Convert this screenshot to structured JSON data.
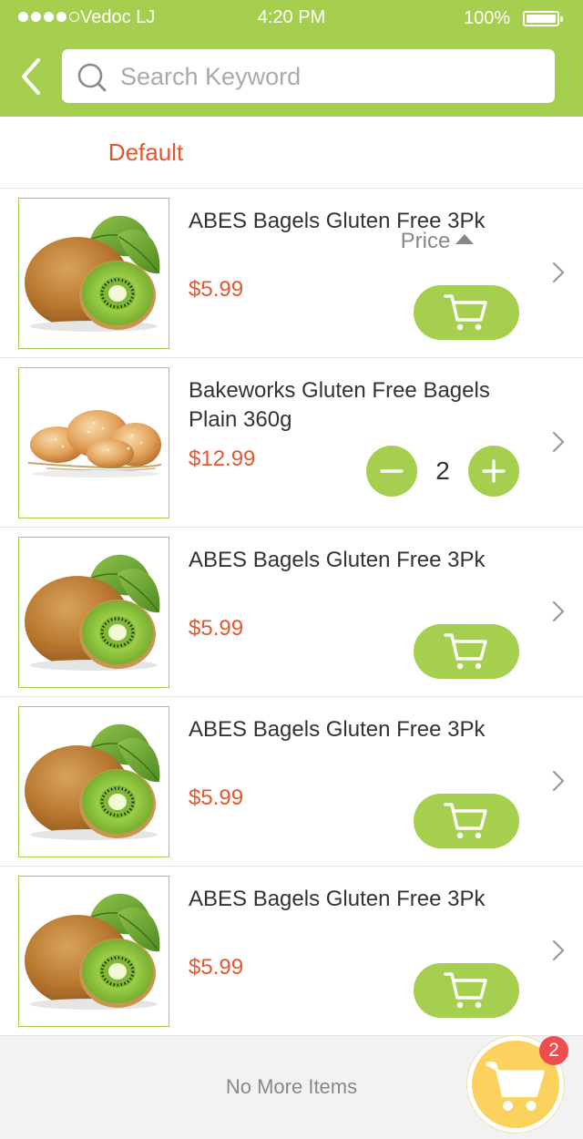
{
  "status_bar": {
    "carrier": "Vedoc LJ",
    "time": "4:20 PM",
    "battery": "100%",
    "signal_bars": 4
  },
  "header": {
    "search_placeholder": "Search Keyword",
    "search_value": ""
  },
  "sort": {
    "default_label": "Default",
    "price_label": "Price",
    "active": "Default"
  },
  "products": [
    {
      "name": "ABES Bagels Gluten Free 3Pk",
      "price": "$5.99",
      "image": "kiwi",
      "in_cart": false
    },
    {
      "name": "Bakeworks Gluten Free Bagels Plain 360g",
      "price": "$12.99",
      "image": "bread",
      "in_cart": true,
      "quantity": "2"
    },
    {
      "name": "ABES Bagels Gluten Free 3Pk",
      "price": "$5.99",
      "image": "kiwi",
      "in_cart": false
    },
    {
      "name": "ABES Bagels Gluten Free 3Pk",
      "price": "$5.99",
      "image": "kiwi",
      "in_cart": false
    },
    {
      "name": "ABES Bagels Gluten Free 3Pk",
      "price": "$5.99",
      "image": "kiwi",
      "in_cart": false
    }
  ],
  "footer": {
    "no_more_label": "No More Items"
  },
  "cart": {
    "badge_count": "2"
  },
  "colors": {
    "brand_green": "#a6cf50",
    "price_red": "#e4572e",
    "cart_yellow": "#fbd25e",
    "badge_red": "#f04e4e"
  }
}
